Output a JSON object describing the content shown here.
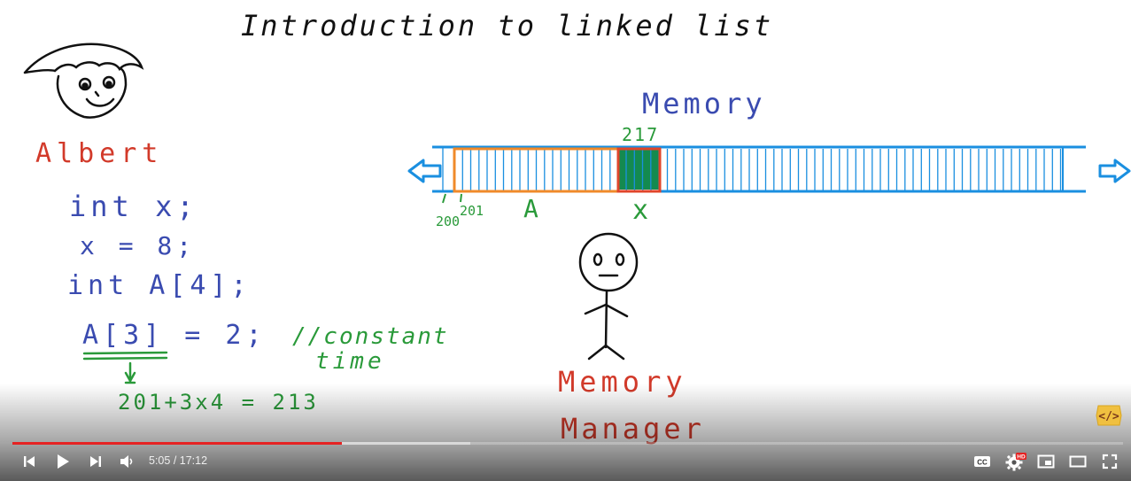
{
  "video": {
    "title": "Introduction to linked list",
    "board": {
      "character_name": "Albert",
      "code_lines": [
        "int x;",
        "x = 8;",
        "int A[4];",
        "A[3] = 2;"
      ],
      "comment_line1": "//constant",
      "comment_line2": "time",
      "address_calc": "201+3x4 = 213",
      "memory_label": "Memory",
      "addr_217": "217",
      "addr_200": "200",
      "addr_201": "201",
      "array_label": "A",
      "var_label": "x",
      "manager_label1": "Memory",
      "manager_label2": "Manager"
    }
  },
  "player": {
    "progress": {
      "played_fraction": 0.297,
      "buffered_fraction": 0.412
    },
    "time": {
      "current": "5:05",
      "separator": " / ",
      "duration": "17:12"
    },
    "buttons": {
      "previous": "previous-icon",
      "play": "play-icon",
      "next": "next-icon",
      "volume": "volume-icon",
      "captions": "cc-icon",
      "settings": "gear-icon",
      "settings_badge": "HD",
      "miniplayer": "miniplayer-icon",
      "theater": "theater-icon",
      "fullscreen": "fullscreen-icon"
    },
    "watermark": "</>"
  }
}
